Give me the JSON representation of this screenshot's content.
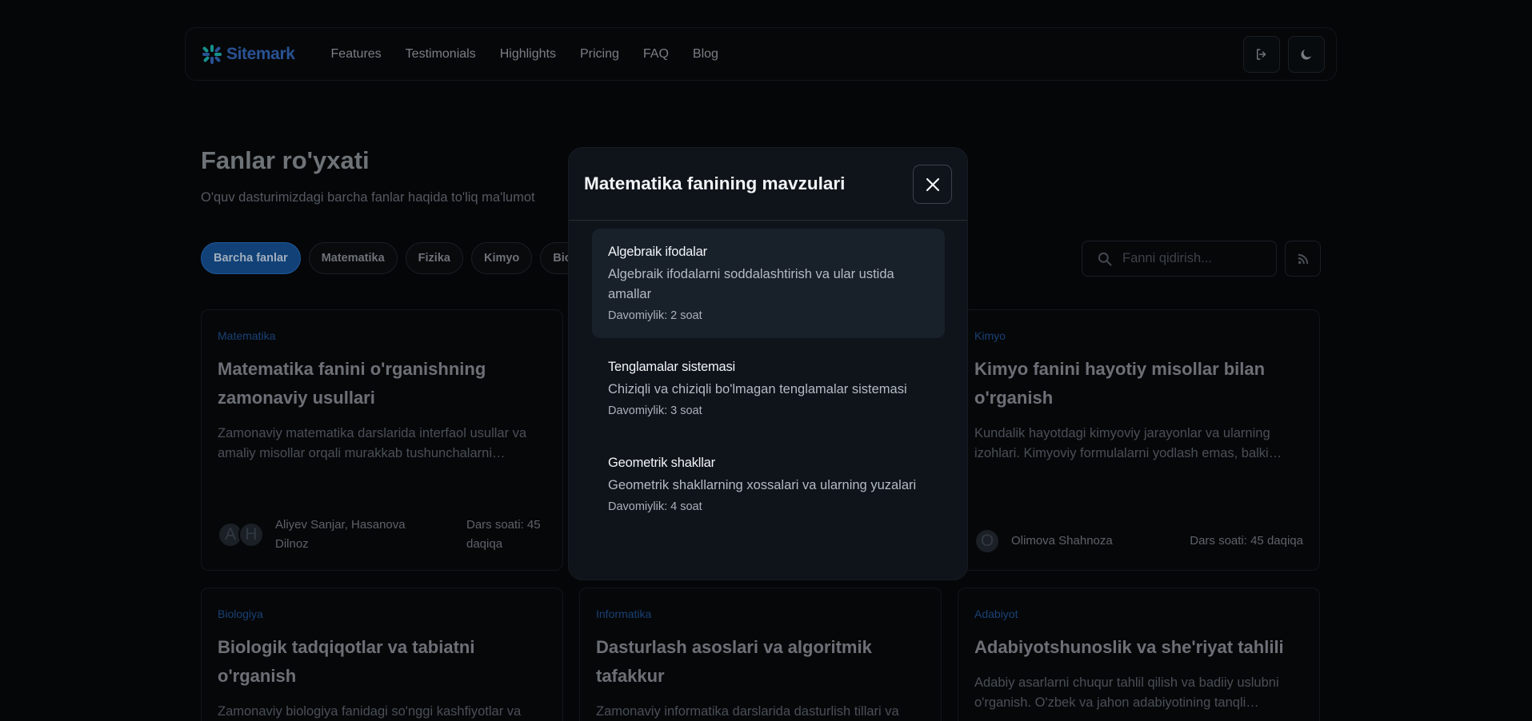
{
  "nav": {
    "brand": "Sitemark",
    "links": [
      "Features",
      "Testimonials",
      "Highlights",
      "Pricing",
      "FAQ",
      "Blog"
    ]
  },
  "header": {
    "title": "Fanlar ro'yxati",
    "subtitle": "O'quv dasturimizdagi barcha fanlar haqida to'liq ma'lumot"
  },
  "filters": [
    "Barcha fanlar",
    "Matematika",
    "Fizika",
    "Kimyo",
    "Bio"
  ],
  "search": {
    "placeholder": "Fanni qidirish..."
  },
  "cards": [
    {
      "category": "Matematika",
      "title": "Matematika fanini o'rganishning zamonaviy usullari",
      "description": "Zamonaviy matematika darslarida interfaol usullar va amaliy misollar orqali murakkab tushunchalarni…",
      "avatars": [
        "A",
        "H"
      ],
      "authors": "Aliyev Sanjar, Hasanova Dilnoz",
      "hours": "Dars soati: 45 daqiqa"
    },
    {
      "category": "Kimyo",
      "title": "Kimyo fanini hayotiy misollar bilan o'rganish",
      "description": "Kundalik hayotdagi kimyoviy jarayonlar va ularning izohlari. Kimyoviy formulalarni yodlash emas, balki…",
      "avatars": [
        "O"
      ],
      "authors": "Olimova Shahnoza",
      "hours": "Dars soati: 45 daqiqa"
    },
    {
      "category": "Biologiya",
      "title": "Biologik tadqiqotlar va tabiatni o'rganish",
      "description": "Zamonaviy biologiya fanidagi so'nggi kashfiyotlar va"
    },
    {
      "category": "Informatika",
      "title": "Dasturlash asoslari va algoritmik tafakkur",
      "description": "Zamonaviy informatika darslarida dasturlish tillari va"
    },
    {
      "category": "Adabiyot",
      "title": "Adabiyotshunoslik va she'riyat tahlili",
      "description": "Adabiy asarlarni chuqur tahlil qilish va badiiy uslubni o'rganish. O'zbek va jahon adabiyotining tanqli…"
    }
  ],
  "modal": {
    "title": "Matematika fanining mavzulari",
    "topics": [
      {
        "name": "Algebraik ifodalar",
        "description": "Algebraik ifodalarni soddalashtirish va ular ustida amallar",
        "duration": "Davomiylik: 2 soat"
      },
      {
        "name": "Tenglamalar sistemasi",
        "description": "Chiziqli va chiziqli bo'lmagan tenglamalar sistemasi",
        "duration": "Davomiylik: 3 soat"
      },
      {
        "name": "Geometrik shakllar",
        "description": "Geometrik shakllarning xossalari va ularning yuzalari",
        "duration": "Davomiylik: 4 soat"
      }
    ]
  },
  "colors": {
    "background": "#060708",
    "accent": "#144a88",
    "brand": "#2f5ea8",
    "modal": "#0f141a"
  }
}
